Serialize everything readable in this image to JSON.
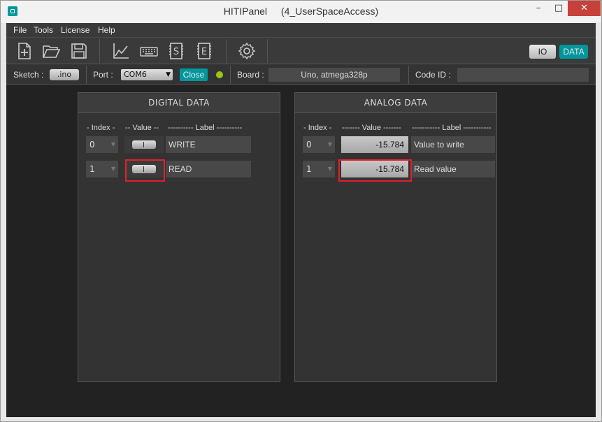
{
  "window": {
    "title": "HITIPanel",
    "subtitle": "(4_UserSpaceAccess)",
    "min_glyph": "–",
    "max_glyph": "□",
    "close_glyph": "✕"
  },
  "menu": [
    "File",
    "Tools",
    "License",
    "Help"
  ],
  "toolbar": {
    "io_label": "IO",
    "data_label": "DATA",
    "tools": [
      "new-file-icon",
      "open-folder-icon",
      "save-icon",
      "chart-icon",
      "keyboard-icon",
      "sketch-s-icon",
      "eeprom-e-icon",
      "gear-icon"
    ]
  },
  "status": {
    "sketch_label": "Sketch :",
    "sketch_button": ".ino",
    "port_label": "Port :",
    "port_value": "COM6",
    "close_label": "Close",
    "led_color": "#9bc70f",
    "board_label": "Board :",
    "board_value": "Uno, atmega328p",
    "code_id_label": "Code ID :",
    "code_id_value": ""
  },
  "digital": {
    "title": "DIGITAL  DATA",
    "col_index": "- Index -",
    "col_value": "-- Value --",
    "col_label": "---------- Label ----------",
    "rows": [
      {
        "index": "0",
        "label": "WRITE"
      },
      {
        "index": "1",
        "label": "READ"
      }
    ]
  },
  "analog": {
    "title": "ANALOG  DATA",
    "col_index": "- Index -",
    "col_value": "------- Value -------",
    "col_label": "----------- Label -----------",
    "rows": [
      {
        "index": "0",
        "value": "-15.784",
        "label": "Value to write"
      },
      {
        "index": "1",
        "value": "-15.784",
        "label": "Read value"
      }
    ]
  },
  "colors": {
    "accent": "#00979c",
    "highlight": "#e0202a",
    "background": "#222222"
  }
}
